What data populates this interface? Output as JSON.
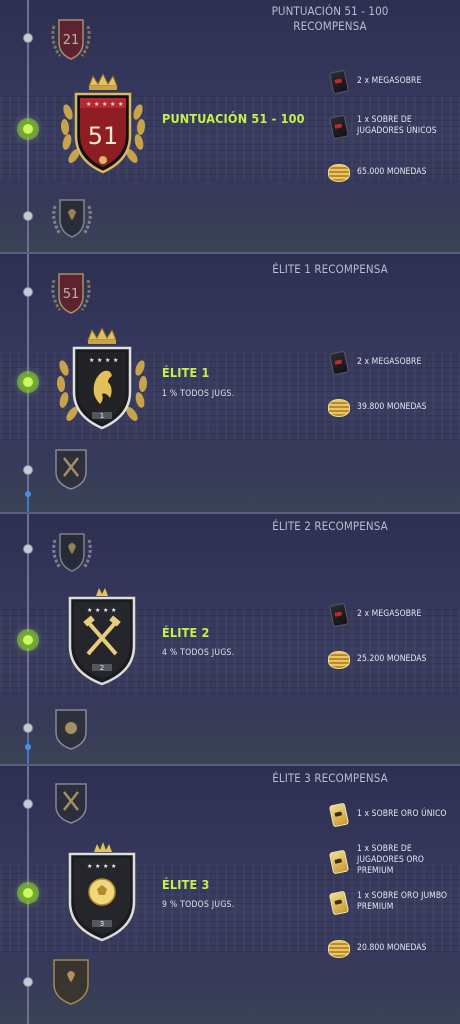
{
  "sections": [
    {
      "reward_title": "PUNTUACIÓN 51 - 100\nRECOMPENSA",
      "reward_title_line1": "PUNTUACIÓN 51 - 100",
      "reward_title_line2": "RECOMPENSA",
      "prev_badge_number": "21",
      "badge_number": "51",
      "badge_label": "PUNTUACIÓN 51 - 100",
      "badge_sub": "",
      "rewards": [
        {
          "icon": "mega-pack-icon",
          "text": "2 x MEGASOBRE"
        },
        {
          "icon": "rare-players-pack-icon",
          "text": "1 x SOBRE DE JUGADORES ÚNICOS"
        },
        {
          "icon": "coins-icon",
          "text": "65.000 MONEDAS"
        }
      ]
    },
    {
      "reward_title_line1": "ÉLITE 1 RECOMPENSA",
      "prev_badge_number": "51",
      "badge_number": "1",
      "badge_label": "ÉLITE 1",
      "badge_sub": "1 % TODOS JUGS.",
      "rewards": [
        {
          "icon": "mega-pack-icon",
          "text": "2 x MEGASOBRE"
        },
        {
          "icon": "coins-icon",
          "text": "39.800 MONEDAS"
        }
      ]
    },
    {
      "reward_title_line1": "ÉLITE 2 RECOMPENSA",
      "badge_number": "2",
      "badge_label": "ÉLITE 2",
      "badge_sub": "4 % TODOS JUGS.",
      "rewards": [
        {
          "icon": "mega-pack-icon",
          "text": "2 x MEGASOBRE"
        },
        {
          "icon": "coins-icon",
          "text": "25.200 MONEDAS"
        }
      ]
    },
    {
      "reward_title_line1": "ÉLITE 3 RECOMPENSA",
      "badge_number": "3",
      "badge_label": "ÉLITE 3",
      "badge_sub": "9 % TODOS JUGS.",
      "rewards": [
        {
          "icon": "gold-pack-icon",
          "text": "1 x SOBRE ORO ÚNICO"
        },
        {
          "icon": "gold-pack-icon",
          "text": "1 x SOBRE DE JUGADORES ORO PREMIUM"
        },
        {
          "icon": "gold-pack-icon",
          "text": "1 x SOBRE ORO JUMBO PREMIUM"
        },
        {
          "icon": "coins-icon",
          "text": "20.800 MONEDAS"
        }
      ]
    }
  ],
  "colors": {
    "accent_green": "#c6f04a",
    "gold": "#d9b45a",
    "red_shield": "#8e1d24",
    "background": "#2b2c4f"
  }
}
